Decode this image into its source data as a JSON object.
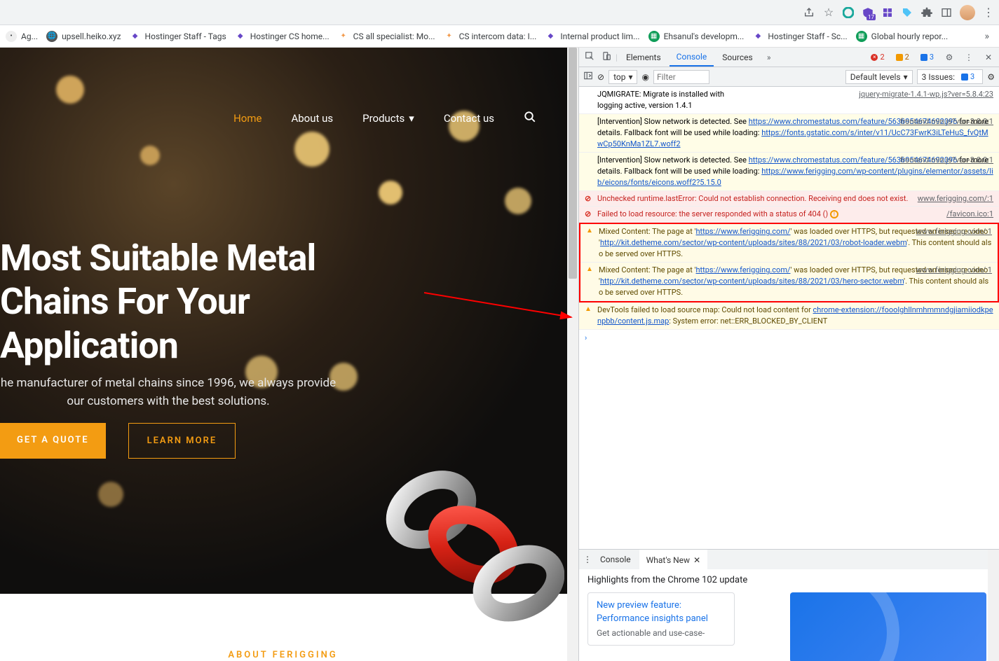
{
  "chrome": {
    "icons": [
      "share",
      "star",
      "ext1",
      "ext2-17",
      "ext3",
      "tag",
      "puzzle",
      "panel",
      "avatar",
      "menu"
    ]
  },
  "bookmarks": [
    {
      "label": "Ag...",
      "color": "#888"
    },
    {
      "label": "upsell.heiko.xyz",
      "color": "#666"
    },
    {
      "label": "Hostinger Staff - Tags",
      "color": "#6747c7"
    },
    {
      "label": "Hostinger CS home...",
      "color": "#6747c7"
    },
    {
      "label": "CS all specialist: Mo...",
      "color": "#f2994a"
    },
    {
      "label": "CS intercom data: I...",
      "color": "#f2994a"
    },
    {
      "label": "Internal product lim...",
      "color": "#6747c7"
    },
    {
      "label": "Ehsanul's developm...",
      "color": "#0f9d58"
    },
    {
      "label": "Hostinger Staff - Sc...",
      "color": "#6747c7"
    },
    {
      "label": "Global hourly repor...",
      "color": "#0f9d58"
    }
  ],
  "page": {
    "nav": {
      "home": "Home",
      "about": "About us",
      "products": "Products",
      "contact": "Contact us"
    },
    "hero_title": "Most Suitable Metal Chains For Your Application",
    "hero_sub": "he manufacturer of metal chains since 1996, we always provide our customers with the best solutions.",
    "btn_quote": "GET A QUOTE",
    "btn_learn": "LEARN MORE",
    "about": "ABOUT FERIGGING"
  },
  "devtools": {
    "tabs": {
      "elements": "Elements",
      "console": "Console",
      "sources": "Sources"
    },
    "counts": {
      "err": "2",
      "warn": "2",
      "info": "3"
    },
    "toolbar": {
      "top": "top",
      "filter_ph": "Filter",
      "levels": "Default levels",
      "issues_lbl": "3 Issues:",
      "issues_n": "3"
    },
    "msgs": {
      "m1a": "JQMIGRATE: Migrate is installed with ",
      "m1l": "jquery-migrate-1.4.1-wp.js?ver=5.8.4:23",
      "m1b": "logging active, version 1.4.1",
      "m2a": "[Intervention] Slow network is detected. See ",
      "m2l1": "https://www.chromestatus.com/feature/5636954674692096",
      "m2src": "frontend.min.js?ver=3.8.0:1",
      "m2b": " for more details. Fallback font will be used while loading: ",
      "m2l2": "https://fonts.gstatic.com/s/inter/v11/UcC73FwrK3iLTeHuS_fvQtMwCp50KnMa1ZL7.woff2",
      "m3l2": "https://www.ferigging.com/wp-content/plugins/elementor/assets/lib/eicons/fonts/eicons.woff2?5.15.0",
      "e1": "Unchecked runtime.lastError: Could not establish connection. Receiving end does not exist.",
      "e1src": "www.ferigging.com/:1",
      "e2": "Failed to load resource: the server responded with a status of 404 ()",
      "e2src": "/favicon.ico:1",
      "w1a": "Mixed Content: The page at '",
      "w1u1": "https://www.ferigging.com/",
      "w1b": "' was loaded over HTTPS, but requested an insecure video '",
      "w1u2": "http://kit.detheme.com/sector/wp-content/uploads/sites/88/2021/03/robot-loader.webm",
      "w1c": "'. This content should also be served over HTTPS.",
      "w1src": "www.ferigging.com/:1",
      "w2u2": "http://kit.detheme.com/sector/wp-content/uploads/sites/88/2021/03/hero-sector.webm",
      "w3a": "DevTools failed to load source map: Could not load content for ",
      "w3u": "chrome-extension://fooolghllnmhmmndgjiamiiodkpenpbb/content.js.map",
      "w3b": ": System error: net::ERR_BLOCKED_BY_CLIENT"
    },
    "drawer": {
      "console_tab": "Console",
      "whatsnew_tab": "What's New",
      "heading": "Highlights from the Chrome 102 update",
      "card_t1": "New preview feature:",
      "card_t2": "Performance insights panel",
      "card_t3": "Get actionable and use-case-"
    }
  }
}
